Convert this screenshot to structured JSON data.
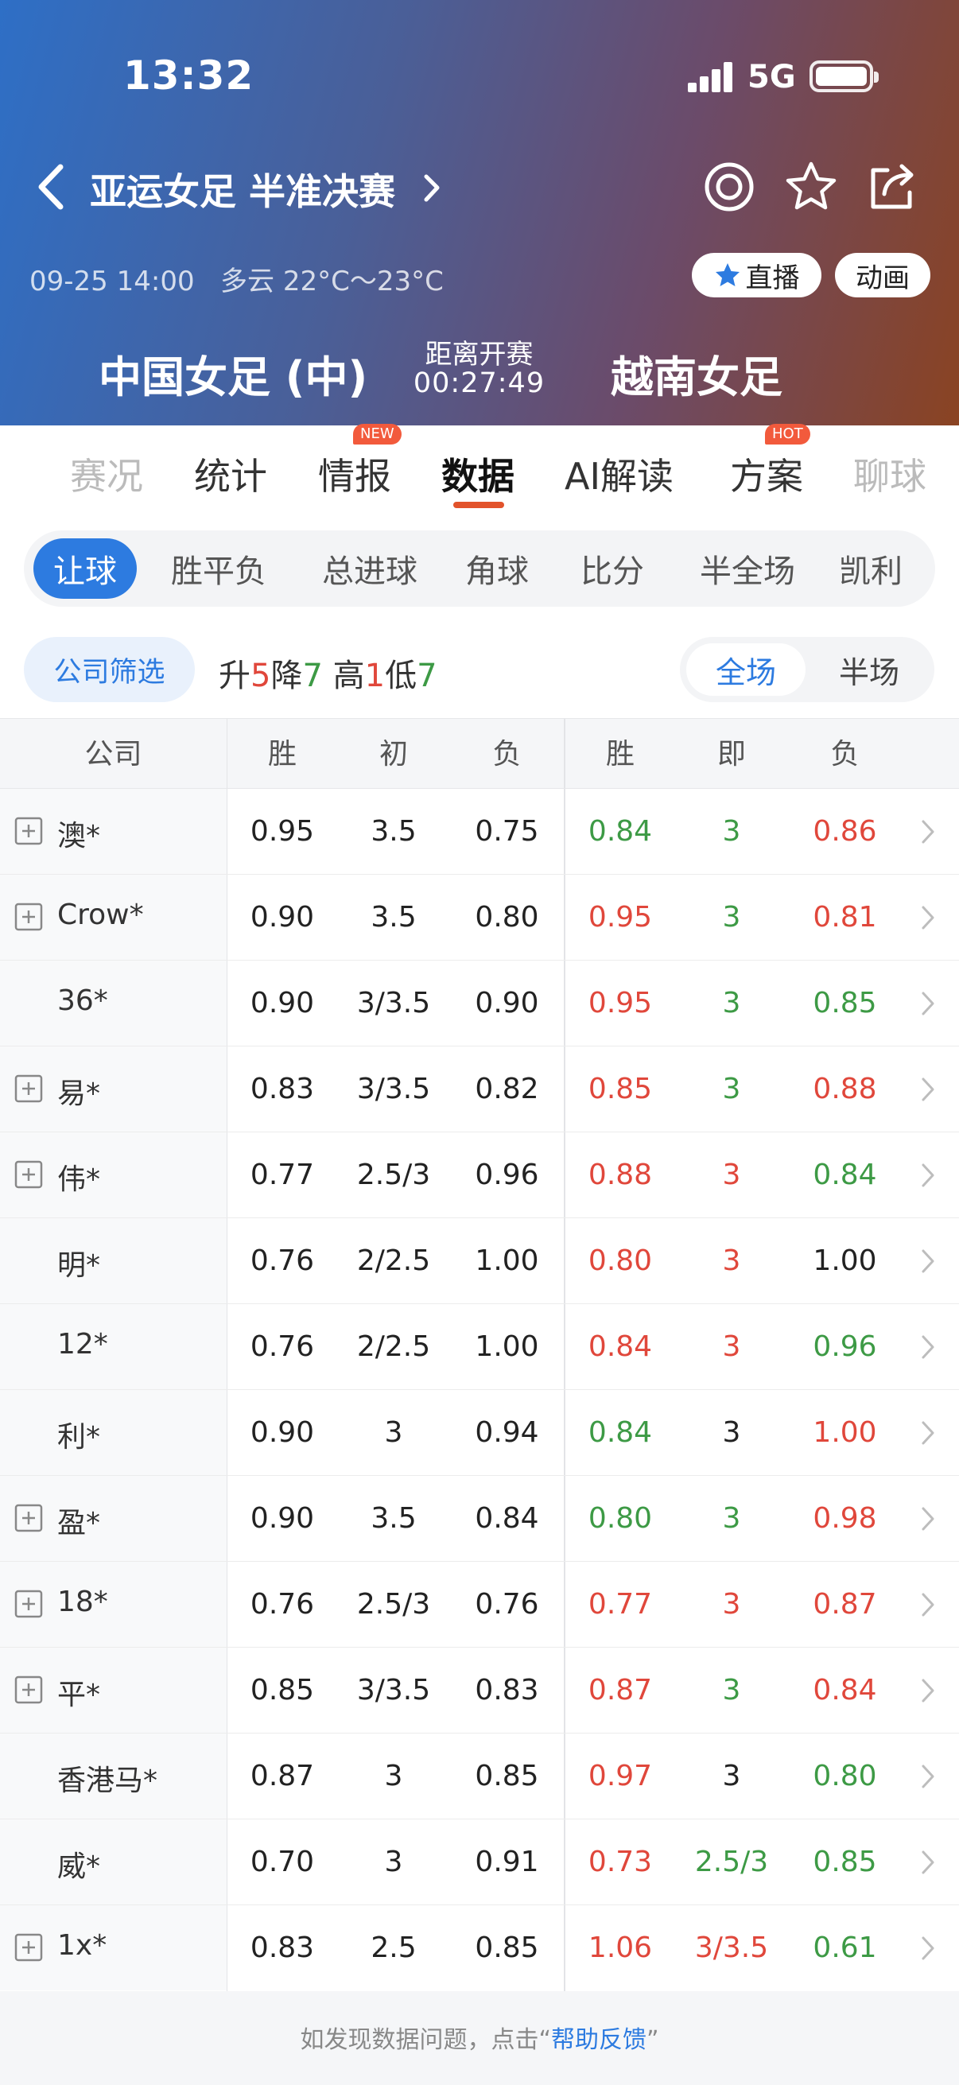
{
  "status_bar": {
    "time": "13:32",
    "network": "5G"
  },
  "header": {
    "title": "亚运女足 半准决赛",
    "date_time": "09-25 14:00",
    "weather": "多云 22°C～23°C",
    "live_label": "直播",
    "animation_label": "动画",
    "home_team": "中国女足 (中)",
    "away_team": "越南女足",
    "countdown_label": "距离开赛",
    "countdown": "00:27:49"
  },
  "main_tabs": [
    {
      "label": "赛况"
    },
    {
      "label": "统计"
    },
    {
      "label": "情报",
      "badge": "NEW"
    },
    {
      "label": "数据"
    },
    {
      "label": "AI解读"
    },
    {
      "label": "方案",
      "badge": "HOT"
    },
    {
      "label": "聊球"
    }
  ],
  "sub_tabs": [
    "让球",
    "胜平负",
    "总进球",
    "角球",
    "比分",
    "半全场",
    "凯利"
  ],
  "filter": {
    "company_filter": "公司筛选",
    "up_label": "升",
    "up_count": "5",
    "down_label": "降",
    "down_count": "7",
    "high_label": "高",
    "high_count": "1",
    "low_label": "低",
    "low_count": "7",
    "scope_full": "全场",
    "scope_half": "半场"
  },
  "table": {
    "headers": {
      "company": "公司",
      "win": "胜",
      "initial": "初",
      "lose": "负",
      "current": "即"
    },
    "rows": [
      {
        "company": "澳*",
        "expandable": true,
        "i_win": "0.95",
        "i_line": "3.5",
        "i_lose": "0.75",
        "c_win": "0.84",
        "c_line": "3",
        "c_lose": "0.86",
        "c_win_color": "#3d9a45",
        "c_line_color": "#3d9a45",
        "c_lose_color": "#e0473b"
      },
      {
        "company": "Crow*",
        "expandable": true,
        "i_win": "0.90",
        "i_line": "3.5",
        "i_lose": "0.80",
        "c_win": "0.95",
        "c_line": "3",
        "c_lose": "0.81",
        "c_win_color": "#e0473b",
        "c_line_color": "#3d9a45",
        "c_lose_color": "#e0473b"
      },
      {
        "company": "36*",
        "expandable": false,
        "i_win": "0.90",
        "i_line": "3/3.5",
        "i_lose": "0.90",
        "c_win": "0.95",
        "c_line": "3",
        "c_lose": "0.85",
        "c_win_color": "#e0473b",
        "c_line_color": "#3d9a45",
        "c_lose_color": "#3d9a45"
      },
      {
        "company": "易*",
        "expandable": true,
        "i_win": "0.83",
        "i_line": "3/3.5",
        "i_lose": "0.82",
        "c_win": "0.85",
        "c_line": "3",
        "c_lose": "0.88",
        "c_win_color": "#e0473b",
        "c_line_color": "#3d9a45",
        "c_lose_color": "#e0473b"
      },
      {
        "company": "伟*",
        "expandable": true,
        "i_win": "0.77",
        "i_line": "2.5/3",
        "i_lose": "0.96",
        "c_win": "0.88",
        "c_line": "3",
        "c_lose": "0.84",
        "c_win_color": "#e0473b",
        "c_line_color": "#e0473b",
        "c_lose_color": "#3d9a45"
      },
      {
        "company": "明*",
        "expandable": false,
        "i_win": "0.76",
        "i_line": "2/2.5",
        "i_lose": "1.00",
        "c_win": "0.80",
        "c_line": "3",
        "c_lose": "1.00",
        "c_win_color": "#e0473b",
        "c_line_color": "#e0473b",
        "c_lose_color": "#222222"
      },
      {
        "company": "12*",
        "expandable": false,
        "i_win": "0.76",
        "i_line": "2/2.5",
        "i_lose": "1.00",
        "c_win": "0.84",
        "c_line": "3",
        "c_lose": "0.96",
        "c_win_color": "#e0473b",
        "c_line_color": "#e0473b",
        "c_lose_color": "#3d9a45"
      },
      {
        "company": "利*",
        "expandable": false,
        "i_win": "0.90",
        "i_line": "3",
        "i_lose": "0.94",
        "c_win": "0.84",
        "c_line": "3",
        "c_lose": "1.00",
        "c_win_color": "#3d9a45",
        "c_line_color": "#222222",
        "c_lose_color": "#e0473b"
      },
      {
        "company": "盈*",
        "expandable": true,
        "i_win": "0.90",
        "i_line": "3.5",
        "i_lose": "0.84",
        "c_win": "0.80",
        "c_line": "3",
        "c_lose": "0.98",
        "c_win_color": "#3d9a45",
        "c_line_color": "#3d9a45",
        "c_lose_color": "#e0473b"
      },
      {
        "company": "18*",
        "expandable": true,
        "i_win": "0.76",
        "i_line": "2.5/3",
        "i_lose": "0.76",
        "c_win": "0.77",
        "c_line": "3",
        "c_lose": "0.87",
        "c_win_color": "#e0473b",
        "c_line_color": "#e0473b",
        "c_lose_color": "#e0473b"
      },
      {
        "company": "平*",
        "expandable": true,
        "i_win": "0.85",
        "i_line": "3/3.5",
        "i_lose": "0.83",
        "c_win": "0.87",
        "c_line": "3",
        "c_lose": "0.84",
        "c_win_color": "#e0473b",
        "c_line_color": "#3d9a45",
        "c_lose_color": "#e0473b"
      },
      {
        "company": "香港马*",
        "expandable": false,
        "i_win": "0.87",
        "i_line": "3",
        "i_lose": "0.85",
        "c_win": "0.97",
        "c_line": "3",
        "c_lose": "0.80",
        "c_win_color": "#e0473b",
        "c_line_color": "#222222",
        "c_lose_color": "#3d9a45"
      },
      {
        "company": "威*",
        "expandable": false,
        "i_win": "0.70",
        "i_line": "3",
        "i_lose": "0.91",
        "c_win": "0.73",
        "c_line": "2.5/3",
        "c_lose": "0.85",
        "c_win_color": "#e0473b",
        "c_line_color": "#3d9a45",
        "c_lose_color": "#3d9a45"
      },
      {
        "company": "1x*",
        "expandable": true,
        "i_win": "0.83",
        "i_line": "2.5",
        "i_lose": "0.85",
        "c_win": "1.06",
        "c_line": "3/3.5",
        "c_lose": "0.61",
        "c_win_color": "#e0473b",
        "c_line_color": "#e0473b",
        "c_lose_color": "#3d9a45"
      }
    ]
  },
  "footer": {
    "text": "如发现数据问题，点击“",
    "link": "帮助反馈",
    "end": "”"
  },
  "icons": {
    "back": "chevron-left-icon",
    "favorite": "star-icon",
    "share": "share-icon",
    "target": "target-icon",
    "live": "star-icon",
    "expand": "plus-box-icon",
    "row": "chevron-right-icon"
  },
  "colors": {
    "accent": "#2d7be0",
    "up_red": "#e0473b",
    "down_green": "#3d9a45",
    "tab_underline": "#e2532b"
  }
}
